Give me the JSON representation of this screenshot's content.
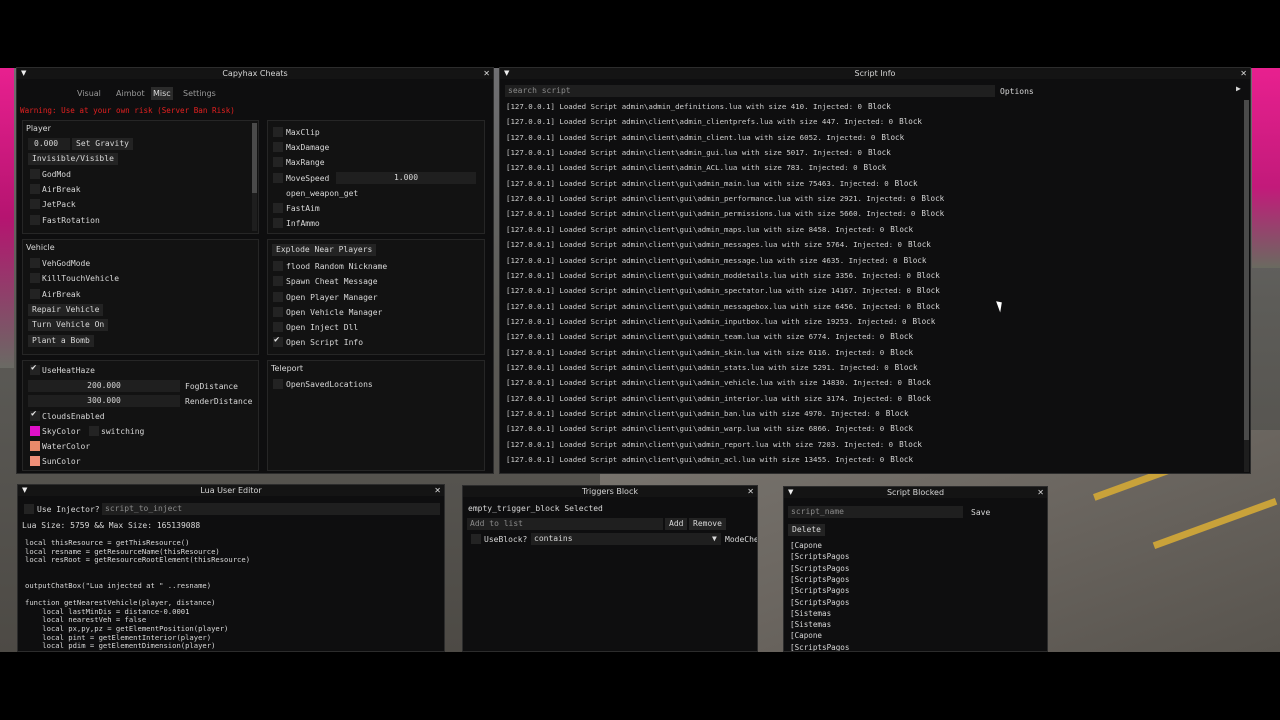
{
  "capyhax": {
    "title": "Capyhax Cheats",
    "tabs": [
      "Visual",
      "Aimbot",
      "Misc",
      "Settings"
    ],
    "active_tab": "Misc",
    "warning": "Warning: Use at your own risk (Server Ban Risk)",
    "player": {
      "header": "Player",
      "gravity_value": "0.000",
      "set_gravity": "Set Gravity",
      "invisible_visible": "Invisible/Visible",
      "items": [
        "GodMod",
        "AirBreak",
        "JetPack",
        "FastRotation"
      ]
    },
    "right_top": {
      "items": [
        "MaxClip",
        "MaxDamage",
        "MaxRange",
        "MoveSpeed",
        "open_weapon_get",
        "FastAim",
        "InfAmmo"
      ],
      "move_speed_value": "1.000"
    },
    "vehicle": {
      "header": "Vehicle",
      "items": [
        "VehGodMode",
        "KillTouchVehicle",
        "AirBreak"
      ],
      "buttons": [
        "Repair Vehicle",
        "Turn Vehicle On",
        "Plant a Bomb"
      ]
    },
    "misc": {
      "explode": "Explode Near Players",
      "items": [
        "flood Random Nickname",
        "Spawn Cheat Message",
        "Open Player Manager",
        "Open Vehicle Manager",
        "Open Inject Dll",
        "Open Script Info"
      ]
    },
    "world": {
      "use_heat_haze": "UseHeatHaze",
      "fog_value": "200.000",
      "fog_label": "FogDistance",
      "render_value": "300.000",
      "render_label": "RenderDistance",
      "clouds": "CloudsEnabled",
      "sky": "SkyColor",
      "switching": "switching",
      "water": "WaterColor",
      "sun": "SunColor",
      "colors": {
        "sky": "#e010c8",
        "water": "#e88a6a",
        "sun": "#ef8f78"
      }
    },
    "teleport": {
      "header": "Teleport",
      "item": "OpenSavedLocations"
    }
  },
  "script_info": {
    "title": "Script Info",
    "search_placeholder": "search script",
    "options": "Options",
    "block_label": "Block",
    "lines": [
      "[127.0.0.1] Loaded Script admin\\admin_definitions.lua with size 410. Injected: 0",
      "[127.0.0.1] Loaded Script admin\\client\\admin_clientprefs.lua with size 447. Injected: 0",
      "[127.0.0.1] Loaded Script admin\\client\\admin_client.lua with size 6052. Injected: 0",
      "[127.0.0.1] Loaded Script admin\\client\\admin_gui.lua with size 5017. Injected: 0",
      "[127.0.0.1] Loaded Script admin\\client\\admin_ACL.lua with size 783. Injected: 0",
      "[127.0.0.1] Loaded Script admin\\client\\gui\\admin_main.lua with size 75463. Injected: 0",
      "[127.0.0.1] Loaded Script admin\\client\\gui\\admin_performance.lua with size 2921. Injected: 0",
      "[127.0.0.1] Loaded Script admin\\client\\gui\\admin_permissions.lua with size 5660. Injected: 0",
      "[127.0.0.1] Loaded Script admin\\client\\gui\\admin_maps.lua with size 8458. Injected: 0",
      "[127.0.0.1] Loaded Script admin\\client\\gui\\admin_messages.lua with size 5764. Injected: 0",
      "[127.0.0.1] Loaded Script admin\\client\\gui\\admin_message.lua with size 4635. Injected: 0",
      "[127.0.0.1] Loaded Script admin\\client\\gui\\admin_moddetails.lua with size 3356. Injected: 0",
      "[127.0.0.1] Loaded Script admin\\client\\gui\\admin_spectator.lua with size 14167. Injected: 0",
      "[127.0.0.1] Loaded Script admin\\client\\gui\\admin_messagebox.lua with size 6456. Injected: 0",
      "[127.0.0.1] Loaded Script admin\\client\\gui\\admin_inputbox.lua with size 19253. Injected: 0",
      "[127.0.0.1] Loaded Script admin\\client\\gui\\admin_team.lua with size 6774. Injected: 0",
      "[127.0.0.1] Loaded Script admin\\client\\gui\\admin_skin.lua with size 6116. Injected: 0",
      "[127.0.0.1] Loaded Script admin\\client\\gui\\admin_stats.lua with size 5291. Injected: 0",
      "[127.0.0.1] Loaded Script admin\\client\\gui\\admin_vehicle.lua with size 14830. Injected: 0",
      "[127.0.0.1] Loaded Script admin\\client\\gui\\admin_interior.lua with size 3174. Injected: 0",
      "[127.0.0.1] Loaded Script admin\\client\\gui\\admin_ban.lua with size 4970. Injected: 0",
      "[127.0.0.1] Loaded Script admin\\client\\gui\\admin_warp.lua with size 6866. Injected: 0",
      "[127.0.0.1] Loaded Script admin\\client\\gui\\admin_report.lua with size 7203. Injected: 0",
      "[127.0.0.1] Loaded Script admin\\client\\gui\\admin_acl.lua with size 13455. Injected: 0"
    ]
  },
  "lua_editor": {
    "title": "Lua User Editor",
    "use_injector": "Use Injector?",
    "injector_placeholder": "script_to_inject",
    "size_info": "Lua Size: 5759 && Max Size: 165139088",
    "code": "local thisResource = getThisResource()\nlocal resname = getResourceName(thisResource)\nlocal resRoot = getResourceRootElement(thisResource)\n\n\noutputChatBox(\"Lua injected at \" ..resname)\n\nfunction getNearestVehicle(player, distance)\n    local lastMinDis = distance-0.0001\n    local nearestVeh = false\n    local px,py,pz = getElementPosition(player)\n    local pint = getElementInterior(player)\n    local pdim = getElementDimension(player)"
  },
  "triggers": {
    "title": "Triggers Block",
    "selected": "empty_trigger_block Selected",
    "add_placeholder": "Add to list",
    "add": "Add",
    "remove": "Remove",
    "use_block": "UseBlock?",
    "mode_value": "contains",
    "mode_label": "ModeChe"
  },
  "script_blocked": {
    "title": "Script Blocked",
    "name_placeholder": "script_name",
    "save": "Save",
    "delete": "Delete",
    "items": [
      "[Capone",
      "[ScriptsPagos",
      "[ScriptsPagos",
      "[ScriptsPagos",
      "[ScriptsPagos",
      "[ScriptsPagos",
      "[Sistemas",
      "[Sistemas",
      "[Capone",
      "[ScriptsPagos"
    ]
  }
}
